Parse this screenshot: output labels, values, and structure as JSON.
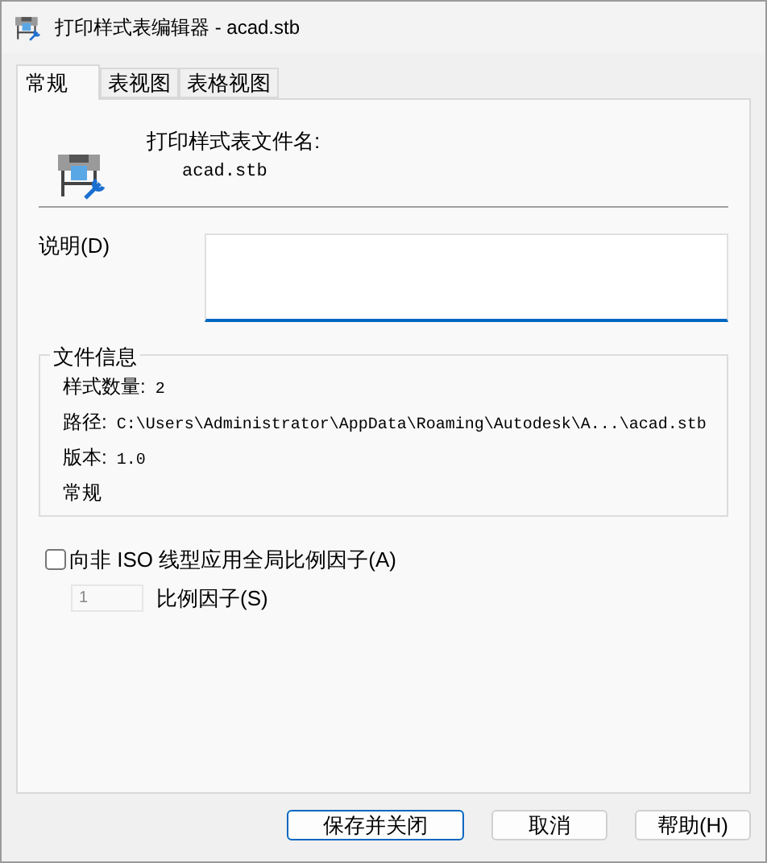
{
  "window": {
    "title": "打印样式表编辑器 - acad.stb"
  },
  "tabs": [
    {
      "label": "常规",
      "selected": true
    },
    {
      "label": "表视图",
      "selected": false
    },
    {
      "label": "表格视图",
      "selected": false
    }
  ],
  "file_name": {
    "label": "打印样式表文件名:",
    "value": "acad.stb"
  },
  "description": {
    "label": "说明(D)"
  },
  "file_info": {
    "title": "文件信息",
    "rows": [
      {
        "label": "样式数量:",
        "value": "2"
      },
      {
        "label": "路径:",
        "value": "C:\\Users\\Administrator\\AppData\\Roaming\\Autodesk\\A...\\acad.stb"
      },
      {
        "label": "版本:",
        "value": "1.0"
      },
      {
        "label": "常规"
      }
    ]
  },
  "scale_option": {
    "label": "向非 ISO 线型应用全局比例因子(A)",
    "checked": false
  },
  "scale_factor": {
    "label": "比例因子(S)",
    "value": "1",
    "disabled": true
  },
  "buttons": [
    {
      "label": "保存并关闭",
      "default": true
    },
    {
      "label": "取消",
      "default": false
    },
    {
      "label": "帮助(H)",
      "default": false
    }
  ]
}
